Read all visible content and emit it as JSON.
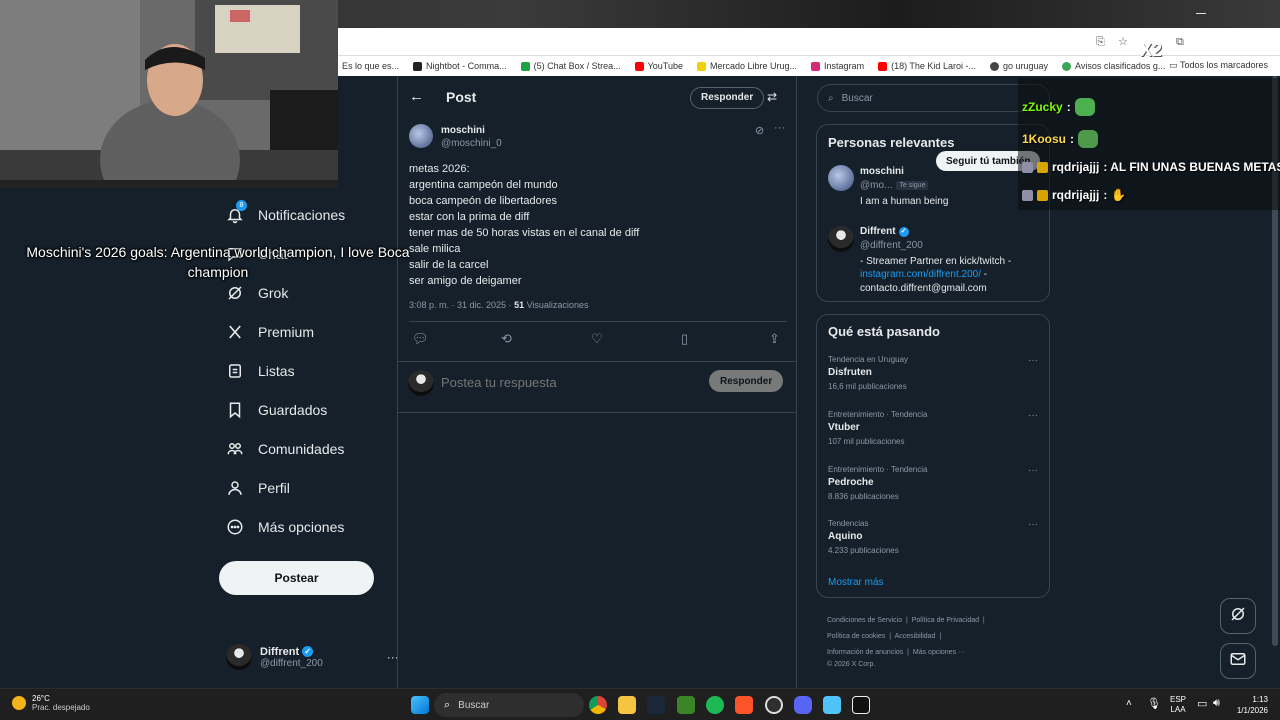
{
  "browser": {
    "bookmarks": [
      {
        "label": "Es lo que es...",
        "color": "#888888"
      },
      {
        "label": "Nightbot - Comma...",
        "color": "#222222"
      },
      {
        "label": "(5) Chat Box / Strea...",
        "color": "#1fa345"
      },
      {
        "label": "YouTube",
        "color": "#ff0000"
      },
      {
        "label": "Mercado Libre Urug...",
        "color": "#f5d000"
      },
      {
        "label": "Instagram",
        "color": "#d62976"
      },
      {
        "label": "(18) The Kid Laroi -...",
        "color": "#ff0000"
      },
      {
        "label": "go uruguay",
        "color": "#444444"
      },
      {
        "label": "Avisos clasificados g...",
        "color": "#3aa655"
      }
    ],
    "all_bookmarks_label": "Todos los marcadores"
  },
  "nav": {
    "items": [
      {
        "label": "Notificaciones",
        "icon": "bell-icon",
        "badge": "8"
      },
      {
        "label": "Chat",
        "icon": "chat-icon"
      },
      {
        "label": "Grok",
        "icon": "grok-icon"
      },
      {
        "label": "Premium",
        "icon": "x-logo-icon"
      },
      {
        "label": "Listas",
        "icon": "list-icon"
      },
      {
        "label": "Guardados",
        "icon": "bookmark-icon"
      },
      {
        "label": "Comunidades",
        "icon": "communities-icon"
      },
      {
        "label": "Perfil",
        "icon": "profile-icon"
      },
      {
        "label": "Más opciones",
        "icon": "more-circle-icon"
      }
    ],
    "post_button": "Postear",
    "account": {
      "name": "Diffrent",
      "handle": "@diffrent_200"
    }
  },
  "post": {
    "header_title": "Post",
    "reply_pill": "Responder",
    "author_name": "moschini",
    "author_handle": "@moschini_0",
    "lines": [
      "metas 2026:",
      "argentina campeón del mundo",
      "boca campeón de libertadores",
      "estar con la prima de diff",
      "tener mas de 50 horas vistas en el canal de diff",
      "sale milica",
      "salir de la carcel",
      "ser amigo de deigamer"
    ],
    "timestamp": "3:08 p. m. · 31 dic. 2025 · ",
    "views_count": "51",
    "views_label": " Visualizaciones",
    "reply_placeholder": "Postea tu respuesta",
    "reply_button": "Responder"
  },
  "right": {
    "search_placeholder": "Buscar",
    "relevant_title": "Personas relevantes",
    "people": [
      {
        "name": "moschini",
        "handle": "@mo...",
        "follows_you": "Te sigue",
        "bio": "I am a human being",
        "follow_button": "Seguir tú también"
      },
      {
        "name": "Diffrent",
        "handle": "@diffrent_200",
        "bio1": "- Streamer Partner en kick/twitch -",
        "link": "instagram.com/diffrent.200/",
        "bio2": " -",
        "bio3": "contacto.diffrent@gmail.com"
      }
    ],
    "trends_title": "Qué está pasando",
    "trends": [
      {
        "context": "Tendencia en Uruguay",
        "name": "Disfruten",
        "count": "16,6 mil publicaciones"
      },
      {
        "context": "Entretenimiento · Tendencia",
        "name": "Vtuber",
        "count": "107 mil publicaciones"
      },
      {
        "context": "Entretenimiento · Tendencia",
        "name": "Pedroche",
        "count": "8.836 publicaciones"
      },
      {
        "context": "Tendencias",
        "name": "Aquino",
        "count": "4.233 publicaciones"
      }
    ],
    "show_more": "Mostrar más",
    "footer": {
      "terms": "Condiciones de Servicio",
      "privacy": "Política de Privacidad",
      "cookies": "Política de cookies",
      "accessibility": "Accesibilidad",
      "ads": "Información de anuncios",
      "more": "Más opciones ···",
      "copyright": "© 2026 X Corp."
    }
  },
  "stream": {
    "caption": "Moschini's 2026 goals: Argentina world champion, I love Boca champion",
    "chat": [
      {
        "user": "zZucky",
        "text": ":",
        "color": "#7CFC00"
      },
      {
        "user": "1Koosu",
        "text": ":",
        "color": "#FFD84D"
      },
      {
        "user": "rqdrijajjj",
        "text": ": AL FIN UNAS BUENAS METAS",
        "color": "#ffffff"
      },
      {
        "user": "rqdrijajjj",
        "text": ":",
        "color": "#ffffff"
      }
    ],
    "overlay_badge": "X2"
  },
  "taskbar": {
    "weather_temp": "26°C",
    "weather_desc": "Prac. despejado",
    "search_label": "Buscar",
    "lang_top": "ESP",
    "lang_bottom": "LAA",
    "time": "1:13",
    "date": "1/1/2026"
  }
}
